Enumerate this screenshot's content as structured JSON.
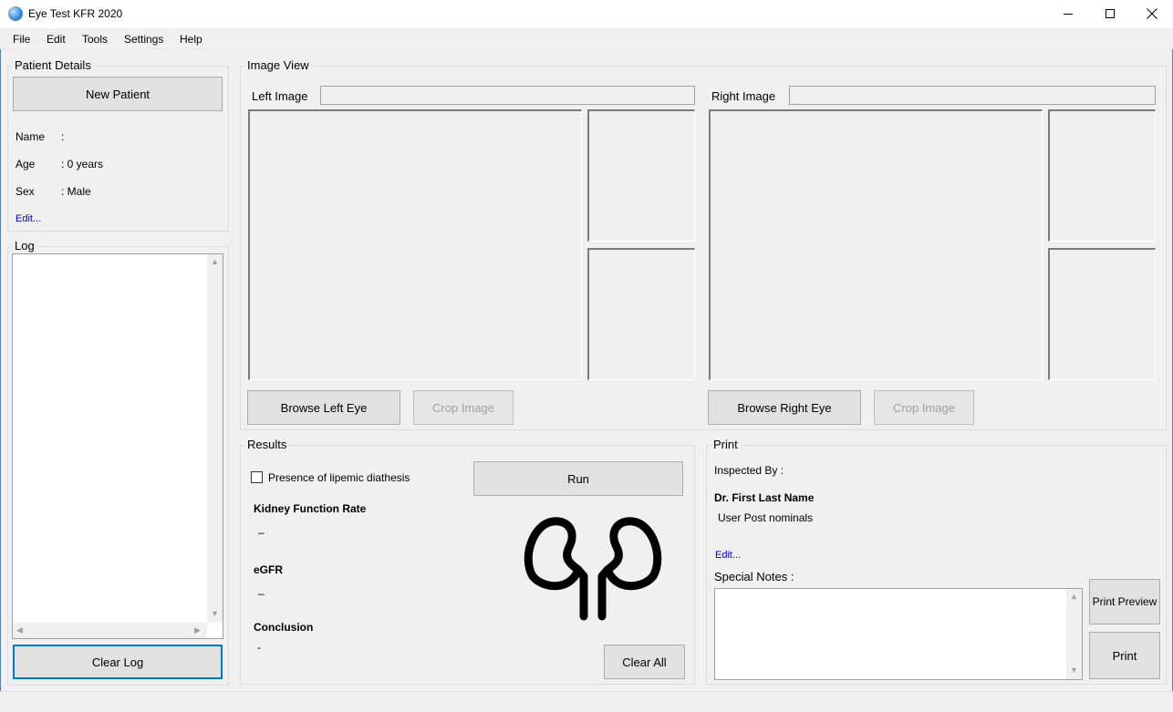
{
  "window": {
    "title": "Eye Test KFR 2020"
  },
  "menu": [
    "File",
    "Edit",
    "Tools",
    "Settings",
    "Help"
  ],
  "patient": {
    "group_title": "Patient Details",
    "new_button": "New Patient",
    "name_label": "Name",
    "name_value": ":",
    "age_label": "Age",
    "age_value": ": 0 years",
    "sex_label": "Sex",
    "sex_value": ": Male",
    "edit_link": "Edit..."
  },
  "log": {
    "group_title": "Log",
    "clear_button": "Clear Log"
  },
  "image_view": {
    "group_title": "Image View",
    "left_label": "Left Image",
    "left_path": "",
    "right_label": "Right Image",
    "right_path": "",
    "browse_left": "Browse Left Eye",
    "crop_left": "Crop Image",
    "browse_right": "Browse Right Eye",
    "crop_right": "Crop Image"
  },
  "results": {
    "group_title": "Results",
    "checkbox_label": "Presence of lipemic diathesis",
    "checkbox_checked": false,
    "run_button": "Run",
    "kfr_label": "Kidney Function Rate",
    "kfr_value": "–",
    "egfr_label": "eGFR",
    "egfr_value": "–",
    "conclusion_label": "Conclusion",
    "conclusion_value": "-",
    "clear_all_button": "Clear All",
    "icon": "kidneys-icon"
  },
  "print": {
    "group_title": "Print",
    "inspected_by_label": "Inspected By :",
    "doctor_name": "Dr. First Last Name",
    "post_nominals": "User Post nominals",
    "edit_link": "Edit...",
    "special_notes_label": "Special Notes :",
    "print_preview_button": "Print Preview",
    "print_button": "Print"
  },
  "colors": {
    "accent": "#0078d7",
    "link": "#0000cc",
    "background": "#f0f0f0"
  }
}
